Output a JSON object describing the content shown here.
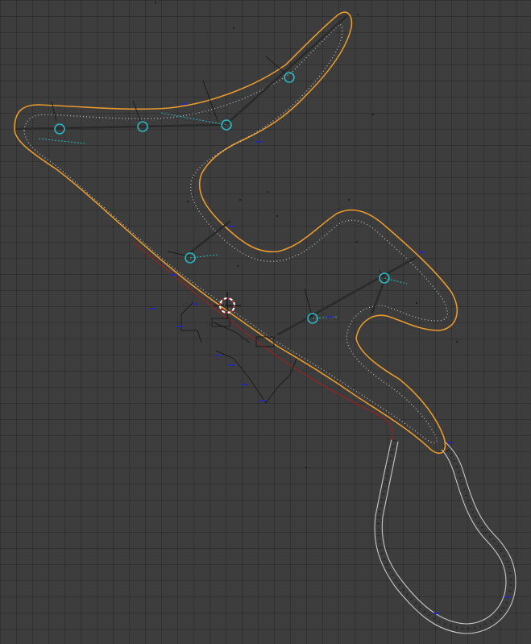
{
  "viewport": {
    "background": "#3d3d3d",
    "grid_color": "#333333",
    "colors": {
      "selected_outline": "#e89a2c",
      "empty_axes": "#2bb5c0",
      "cursor": "#c8262b",
      "curve": "#a41e1e",
      "rail": "#c8c8c8",
      "label": "#2a2aa8"
    },
    "icons": [
      "3d-cursor-icon",
      "empty-object-icon"
    ]
  }
}
